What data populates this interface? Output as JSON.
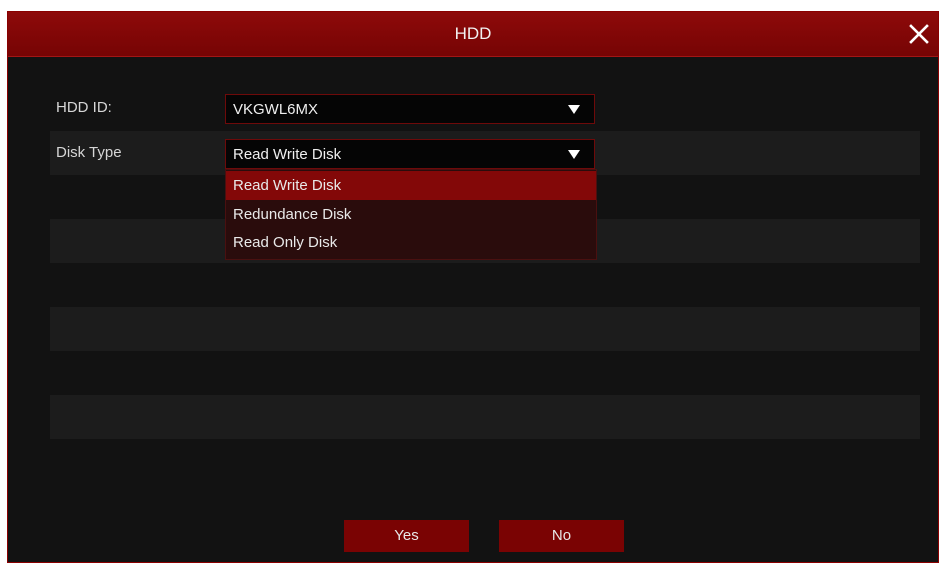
{
  "dialog": {
    "title": "HDD",
    "close_icon": "close-icon"
  },
  "fields": {
    "hdd_id": {
      "label": "HDD ID:",
      "value": "VKGWL6MX"
    },
    "disk_type": {
      "label": "Disk Type",
      "value": "Read Write Disk",
      "options": [
        "Read Write Disk",
        "Redundance Disk",
        "Read Only Disk"
      ],
      "selected_index": 0
    }
  },
  "buttons": {
    "yes_label": "Yes",
    "no_label": "No"
  },
  "colors": {
    "accent": "#7a0303",
    "highlight": "#830808",
    "background": "#121212"
  }
}
